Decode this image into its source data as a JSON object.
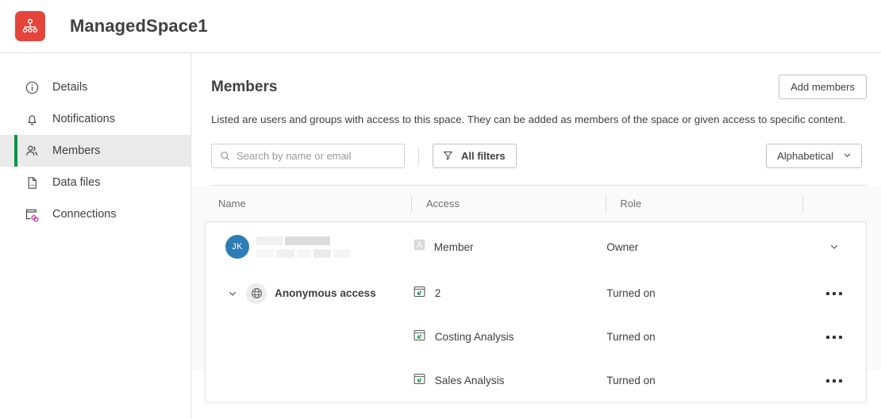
{
  "header": {
    "space_title": "ManagedSpace1",
    "logo_icon": "managed-space-icon",
    "logo_color": "#e4443b"
  },
  "sidebar": {
    "items": [
      {
        "label": "Details",
        "icon": "info-circle-icon",
        "selected": false
      },
      {
        "label": "Notifications",
        "icon": "bell-icon",
        "selected": false
      },
      {
        "label": "Members",
        "icon": "people-icon",
        "selected": true
      },
      {
        "label": "Data files",
        "icon": "data-file-icon",
        "selected": false
      },
      {
        "label": "Connections",
        "icon": "connections-icon",
        "selected": false
      }
    ],
    "selected_accent": "#009845",
    "selected_background": "#eaeaea"
  },
  "main": {
    "title": "Members",
    "description": "Listed are users and groups with access to this space. They can be added as members of the space or given access to specific content.",
    "add_members_label": "Add members",
    "search": {
      "placeholder": "Search by name or email",
      "value": "",
      "icon": "search-icon"
    },
    "filters": {
      "label": "All filters",
      "icon": "filter-funnel-icon"
    },
    "sort": {
      "label": "Alphabetical",
      "icon": "chevron-down-icon"
    }
  },
  "table": {
    "columns": [
      {
        "label": "Name"
      },
      {
        "label": "Access"
      },
      {
        "label": "Role"
      },
      {
        "label": ""
      }
    ],
    "rows": [
      {
        "type": "user",
        "avatar_initials": "JK",
        "avatar_color": "#2e7cb5",
        "name_redacted": true,
        "access_icon": "member-badge-icon",
        "access": "Member",
        "role": "Owner",
        "action_icon": "chevron-down-icon"
      },
      {
        "type": "group",
        "expander_icon": "chevron-down-icon",
        "group_icon": "globe-icon",
        "name": "Anonymous access",
        "access_icon": "app-chart-icon",
        "access": "2",
        "role": "Turned on",
        "action_icon": "more-horizontal-icon"
      },
      {
        "type": "content",
        "access_icon": "app-chart-icon",
        "access": "Costing Analysis",
        "role": "Turned on",
        "action_icon": "more-horizontal-icon"
      },
      {
        "type": "content",
        "access_icon": "app-chart-icon",
        "access": "Sales Analysis",
        "role": "Turned on",
        "action_icon": "more-horizontal-icon"
      }
    ]
  }
}
